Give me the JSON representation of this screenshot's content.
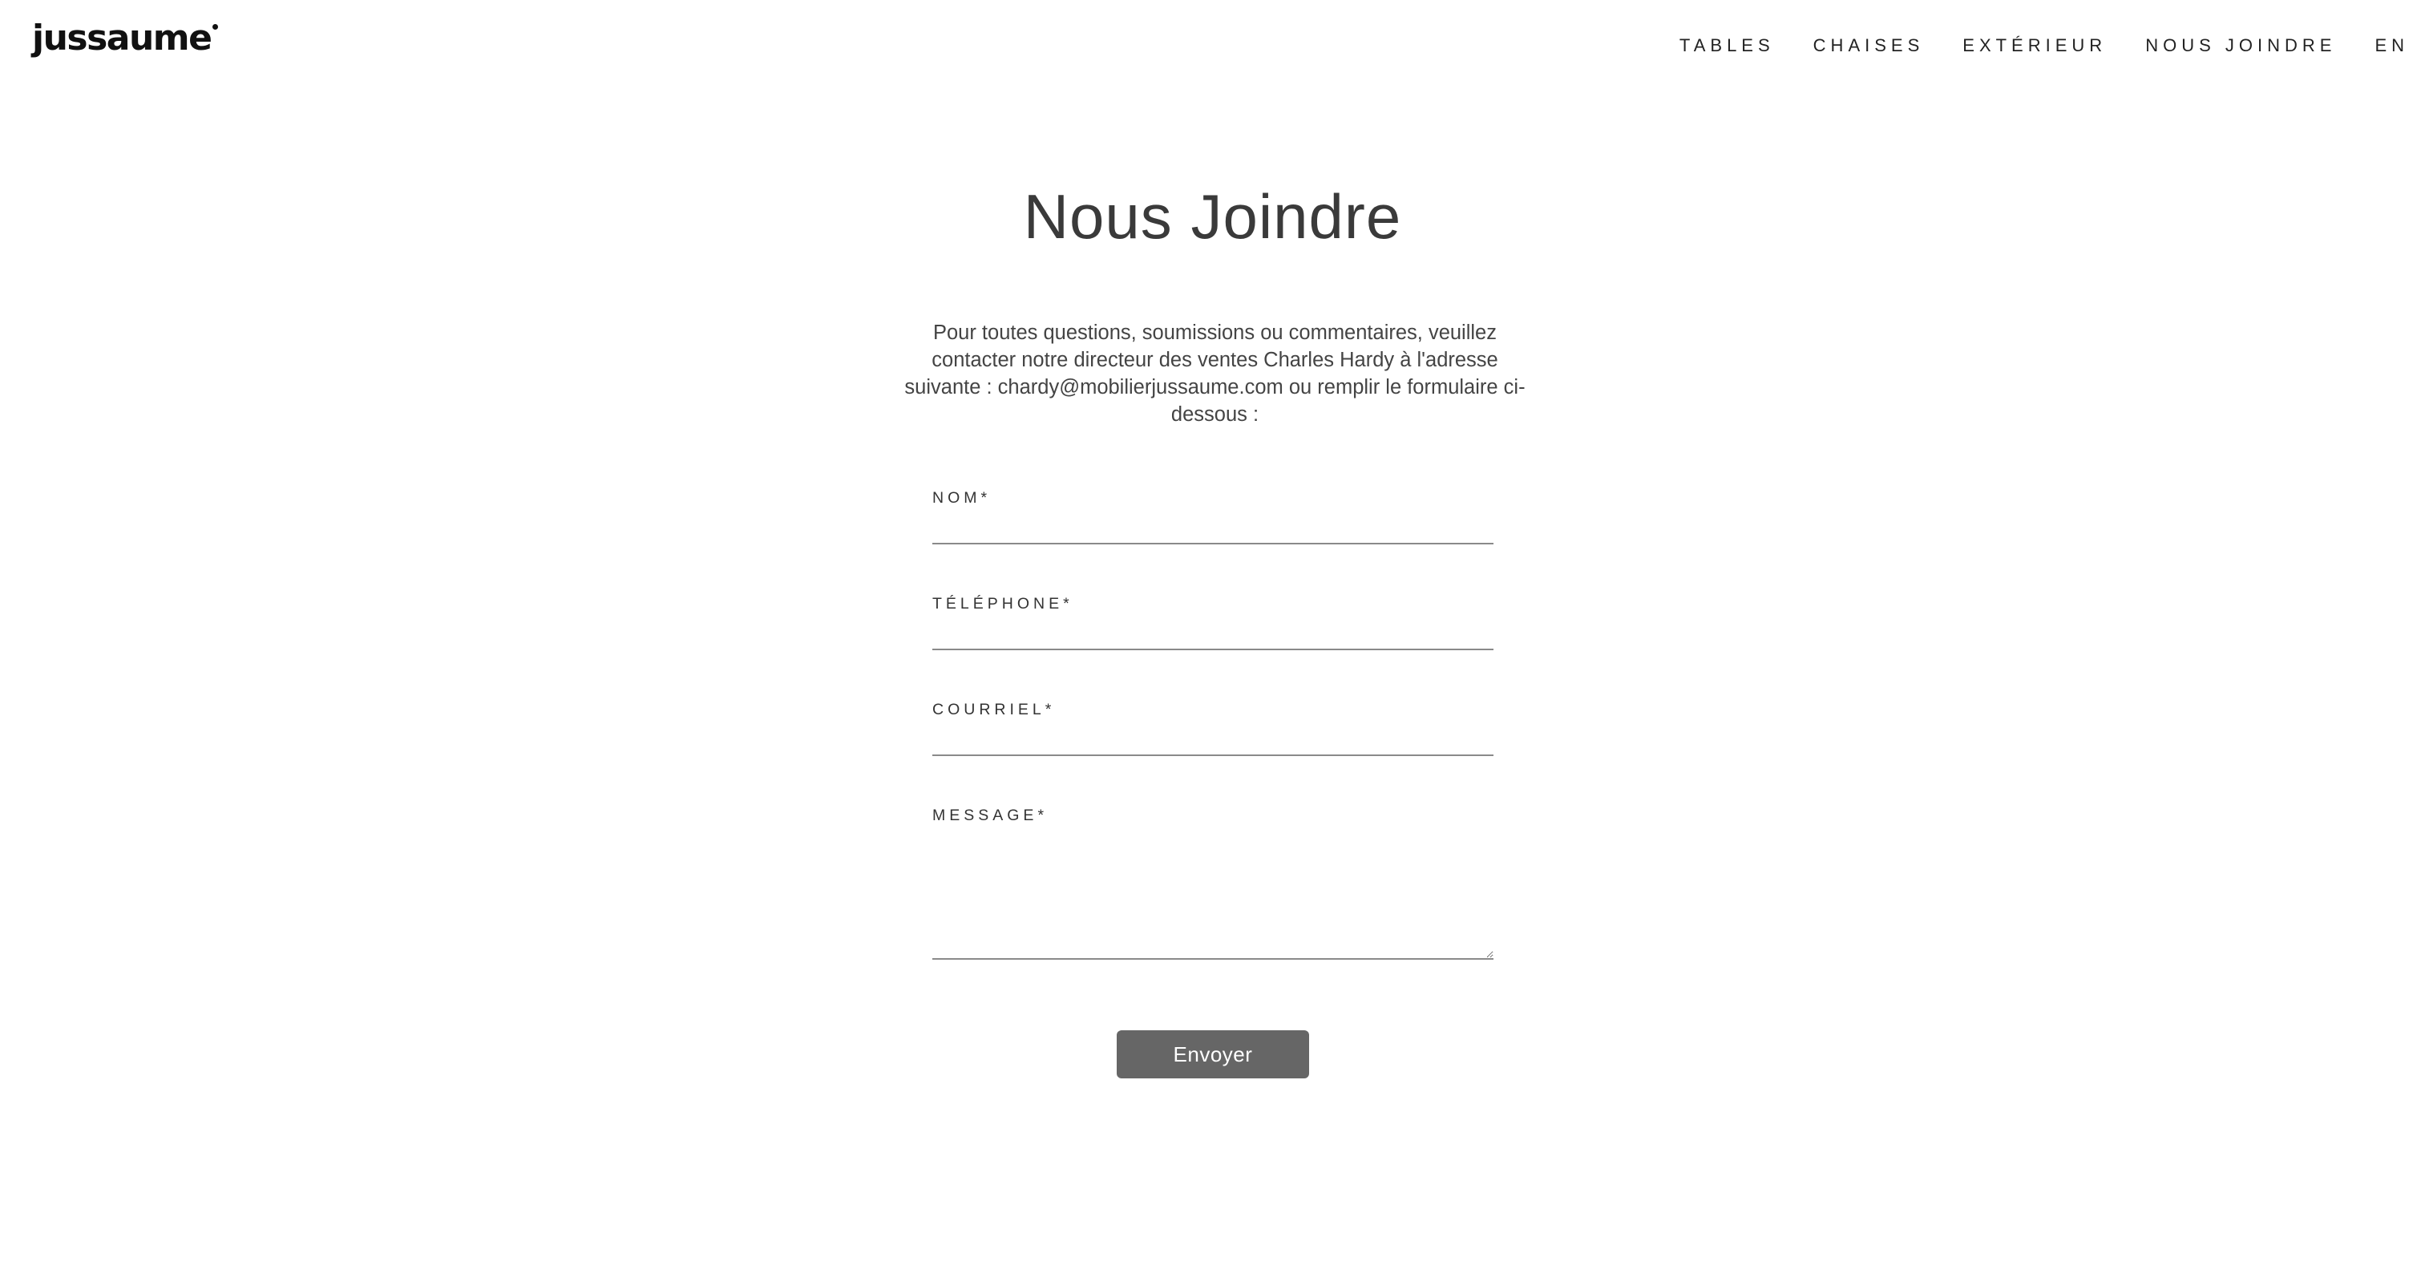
{
  "header": {
    "logo_text": "jussaume",
    "nav": [
      {
        "label": "TABLES"
      },
      {
        "label": "CHAISES"
      },
      {
        "label": "EXTÉRIEUR"
      },
      {
        "label": "NOUS JOINDRE"
      },
      {
        "label": "EN"
      }
    ]
  },
  "main": {
    "title": "Nous Joindre",
    "intro": "Pour toutes questions, soumissions ou commentaires, veuillez contacter notre directeur des ventes Charles Hardy à l'adresse suivante : chardy@mobilierjussaume.com ou remplir le formulaire ci-dessous :"
  },
  "form": {
    "fields": [
      {
        "label": "NOM*",
        "value": "",
        "placeholder": ""
      },
      {
        "label": "TÉLÉPHONE*",
        "value": "",
        "placeholder": ""
      },
      {
        "label": "COURRIEL*",
        "value": "",
        "placeholder": ""
      },
      {
        "label": "MESSAGE*",
        "value": "",
        "placeholder": ""
      }
    ],
    "submit_label": "Envoyer"
  },
  "colors": {
    "button_bg": "#666666",
    "text": "#333333",
    "input_border": "#8a8a8a"
  }
}
